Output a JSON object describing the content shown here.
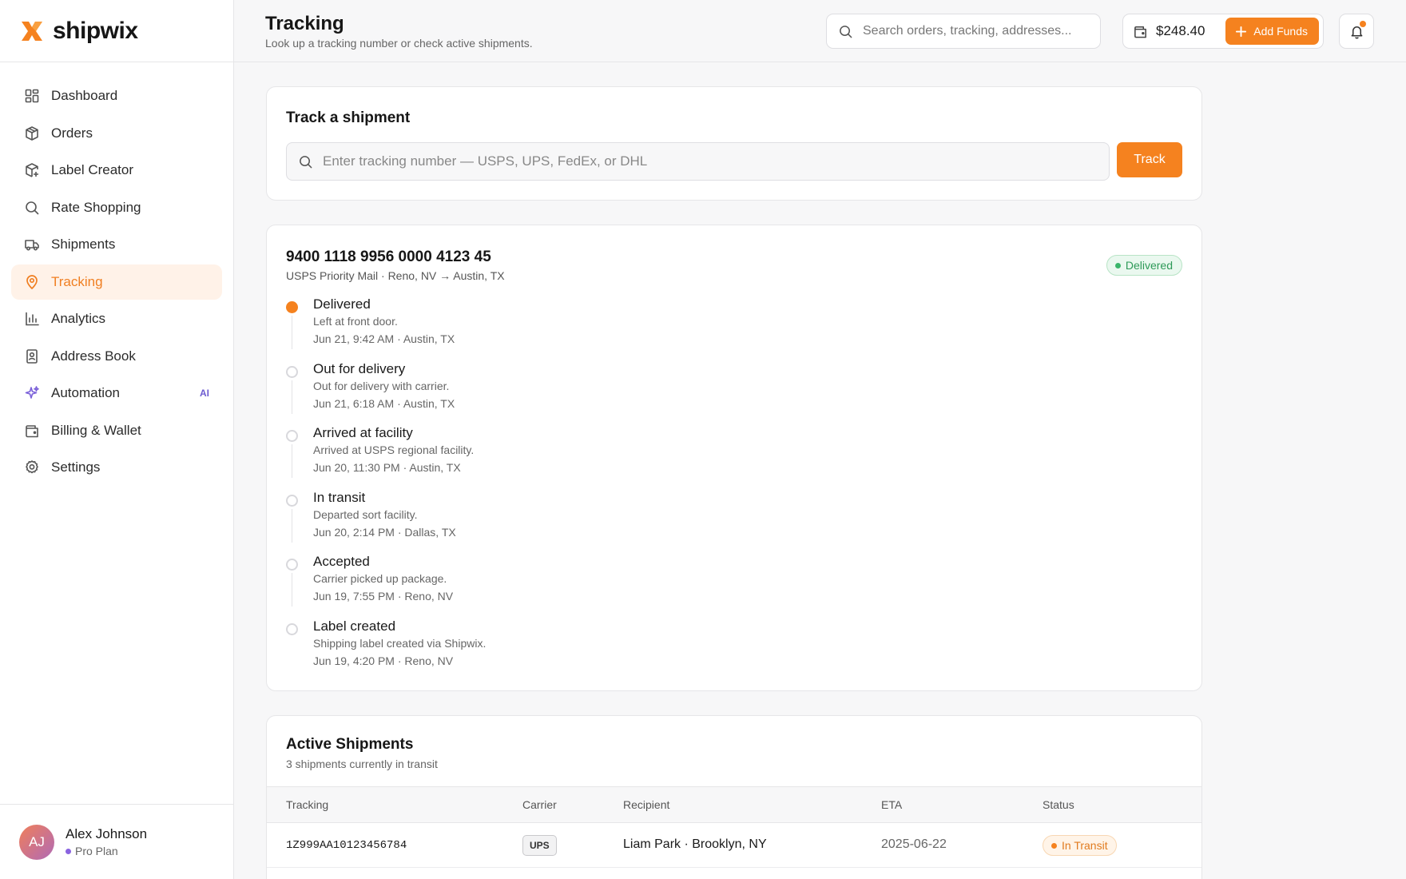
{
  "brand": {
    "name": "shipwix",
    "logo_icon": "x-logo-icon",
    "logo_color": "#f5821f"
  },
  "sidebar": {
    "items": [
      {
        "label": "Dashboard",
        "icon": "grid-icon"
      },
      {
        "label": "Orders",
        "icon": "box-icon"
      },
      {
        "label": "Label Creator",
        "icon": "box-plus-icon"
      },
      {
        "label": "Rate Shopping",
        "icon": "search-icon"
      },
      {
        "label": "Shipments",
        "icon": "truck-icon"
      },
      {
        "label": "Tracking",
        "icon": "map-pin-icon",
        "active": true
      },
      {
        "label": "Analytics",
        "icon": "bar-chart-icon"
      },
      {
        "label": "Address Book",
        "icon": "contact-book-icon"
      },
      {
        "label": "Automation",
        "icon": "sparkles-icon",
        "badge": "AI"
      },
      {
        "label": "Billing & Wallet",
        "icon": "wallet-icon"
      },
      {
        "label": "Settings",
        "icon": "gear-icon"
      }
    ],
    "active_color": "#f07f22"
  },
  "profile": {
    "initials": "AJ",
    "name": "Alex Johnson",
    "plan": "Pro Plan"
  },
  "header": {
    "title": "Tracking",
    "subtitle": "Look up a tracking number or check active shipments.",
    "search_placeholder": "Search orders, tracking, addresses...",
    "wallet_balance": "$248.40",
    "add_funds_label": "Add Funds"
  },
  "track_card": {
    "title": "Track a shipment",
    "input_placeholder": "Enter tracking number — USPS, UPS, FedEx, or DHL",
    "button_label": "Track"
  },
  "detail": {
    "tracking_number": "9400 1118 9956 0000 4123 45",
    "route": "USPS Priority Mail · Reno, NV → Austin, TX",
    "status": "Delivered",
    "status_color": "#2e9a58",
    "events": [
      {
        "title": "Delivered",
        "desc": "Left at front door.",
        "meta": "Jun 21, 9:42 AM · Austin, TX",
        "current": true
      },
      {
        "title": "Out for delivery",
        "desc": "Out for delivery with carrier.",
        "meta": "Jun 21, 6:18 AM · Austin, TX"
      },
      {
        "title": "Arrived at facility",
        "desc": "Arrived at USPS regional facility.",
        "meta": "Jun 20, 11:30 PM · Austin, TX"
      },
      {
        "title": "In transit",
        "desc": "Departed sort facility.",
        "meta": "Jun 20, 2:14 PM · Dallas, TX"
      },
      {
        "title": "Accepted",
        "desc": "Carrier picked up package.",
        "meta": "Jun 19, 7:55 PM · Reno, NV"
      },
      {
        "title": "Label created",
        "desc": "Shipping label created via Shipwix.",
        "meta": "Jun 19, 4:20 PM · Reno, NV"
      }
    ]
  },
  "active": {
    "title": "Active Shipments",
    "subtitle": "3 shipments currently in transit",
    "columns": [
      "Tracking",
      "Carrier",
      "Recipient",
      "ETA",
      "Status"
    ],
    "rows": [
      {
        "tracking": "1Z999AA10123456784",
        "carrier": "UPS",
        "recipient": "Liam Park · Brooklyn, NY",
        "eta": "2025-06-22",
        "status": "In Transit"
      }
    ]
  }
}
